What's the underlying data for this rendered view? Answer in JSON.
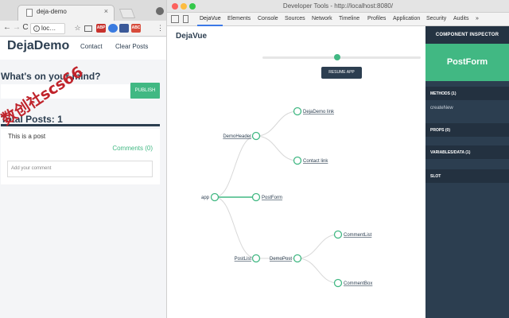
{
  "browser": {
    "tab_title": "deja-demo",
    "tab_close": "×",
    "back": "←",
    "forward": "→",
    "reload": "C",
    "address": "loc…",
    "info_glyph": "i",
    "star": "☆",
    "menu": "⋮",
    "extensions": [
      {
        "label": "ABP",
        "color": "#c8322d"
      },
      {
        "label": "",
        "color": "#3a7be0"
      },
      {
        "label": "",
        "color": "#3b5998"
      },
      {
        "label": "ABC",
        "color": "#d74c3c"
      }
    ]
  },
  "app": {
    "brand": "DejaDemo",
    "nav": [
      "Contact",
      "Clear Posts"
    ],
    "prompt_title": "What's on your mind?",
    "publish_label": "PUBLISH",
    "total_posts": "Total Posts: 1",
    "post": {
      "text": "This is a post",
      "comments": "Comments (0)",
      "comment_placeholder": "Add your comment"
    }
  },
  "watermark": "数创社scs66",
  "devtools": {
    "window_title": "Developer Tools - http://localhost:8080/",
    "tabs": [
      "DejaVue",
      "Elements",
      "Console",
      "Sources",
      "Network",
      "Timeline",
      "Profiles",
      "Application",
      "Security",
      "Audits",
      "»"
    ],
    "active_tab": "DejaVue",
    "traffic_lights": [
      "#fc615d",
      "#fdbc40",
      "#34c84a"
    ],
    "panel_title": "DejaVue",
    "timeline_position": 0.47,
    "resume_label": "RESUME APP",
    "tree": {
      "app": "app",
      "nodes": [
        "DemoHeader",
        "DejaDemo link",
        "Contact link",
        "PostForm",
        "PostList",
        "DemoPost",
        "CommentList",
        "CommentBox"
      ]
    },
    "inspector": {
      "header": "COMPONENT INSPECTOR",
      "component": "PostForm",
      "methods_title": "METHODS (1)",
      "method": "createNew",
      "props_title": "PROPS (0)",
      "vars_title": "VARIABLES/DATA (1)",
      "slot_title": "SLOT"
    }
  },
  "colors": {
    "accent": "#41b883",
    "dark": "#2c3e50"
  }
}
